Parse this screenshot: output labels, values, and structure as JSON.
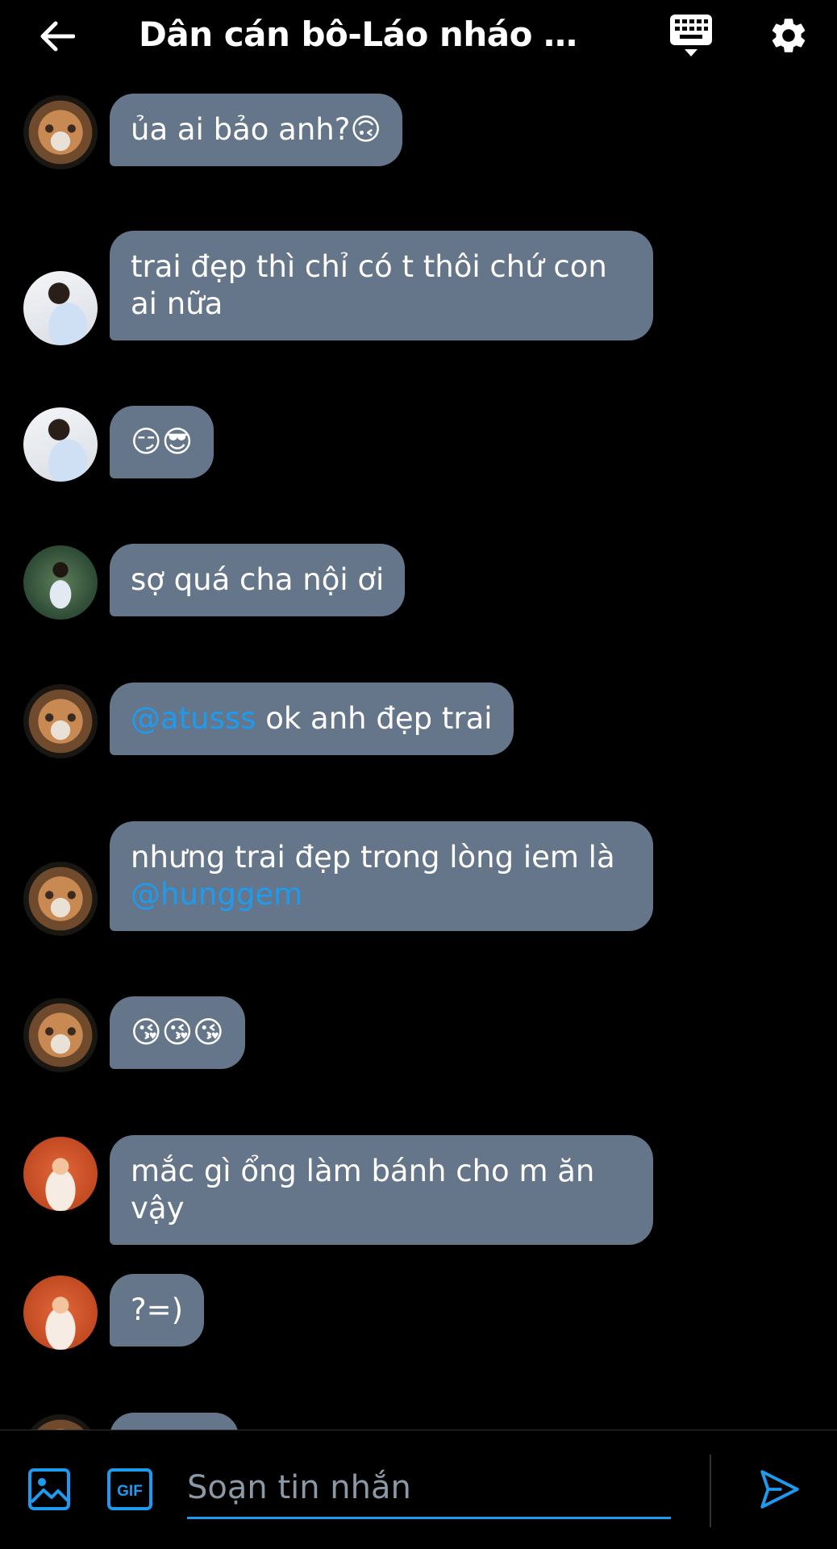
{
  "header": {
    "title": "Dân cán bô-Láo nháo múc ...",
    "back_icon": "arrow-left-icon",
    "keyboard_icon": "keyboard-icon",
    "settings_icon": "gear-icon"
  },
  "messages": [
    {
      "avatar": "cat",
      "parts": [
        {
          "text": "ủa ai bảo anh?🙃"
        }
      ]
    },
    {
      "avatar": "boy-white-shirt",
      "parts": [
        {
          "text": "trai đẹp thì chỉ có t thôi chứ con ai nữa"
        }
      ]
    },
    {
      "avatar": "boy-white-shirt",
      "parts": [
        {
          "text": "😏😎"
        }
      ]
    },
    {
      "avatar": "boy-standing",
      "parts": [
        {
          "text": "sợ quá cha nội ơi"
        }
      ]
    },
    {
      "avatar": "cat",
      "parts": [
        {
          "text": "@atusss",
          "mention": true
        },
        {
          "text": " ok anh đẹp trai"
        }
      ]
    },
    {
      "avatar": "cat",
      "parts": [
        {
          "text": "nhưng trai đẹp trong lòng iem là "
        },
        {
          "text": "@hunggem",
          "mention": true
        }
      ]
    },
    {
      "avatar": "cat",
      "parts": [
        {
          "text": "😘😘😘"
        }
      ]
    },
    {
      "avatar": "girl-orange",
      "parts": [
        {
          "text": "mắc gì ổng làm bánh cho m ăn vậy"
        }
      ]
    },
    {
      "avatar": "girl-orange",
      "parts": [
        {
          "text": "?=)"
        }
      ]
    },
    {
      "avatar": "cat",
      "parts": [
        {
          "text": ""
        }
      ]
    }
  ],
  "composer": {
    "placeholder": "Soạn tin nhắn",
    "image_icon": "image-icon",
    "gif_label": "GIF",
    "send_icon": "send-icon"
  },
  "colors": {
    "background": "#000000",
    "bubble": "#66768a",
    "accent": "#1d9bf0",
    "placeholder": "#8b98a5"
  }
}
